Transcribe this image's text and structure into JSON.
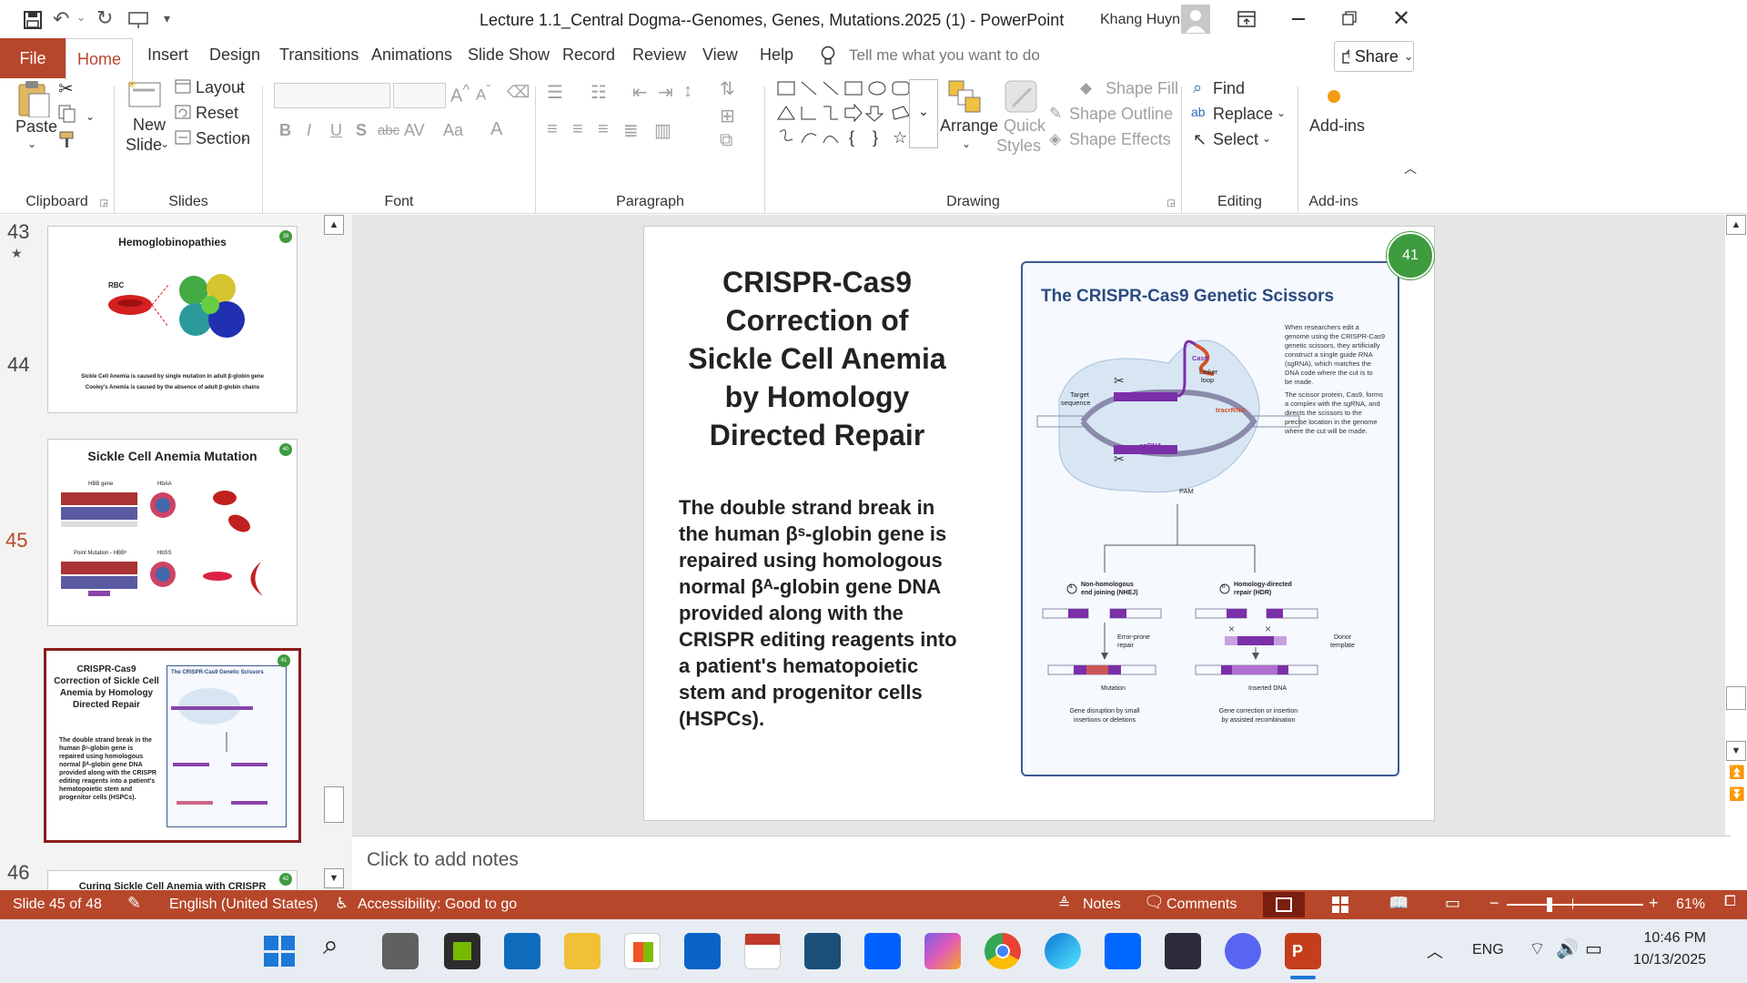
{
  "window": {
    "title": "Lecture 1.1_Central Dogma--Genomes, Genes, Mutations.2025 (1)  -  PowerPoint",
    "user": "Khang Huynh"
  },
  "tabs": [
    "File",
    "Home",
    "Insert",
    "Design",
    "Transitions",
    "Animations",
    "Slide Show",
    "Record",
    "Review",
    "View",
    "Help"
  ],
  "tell_me": "Tell me what you want to do",
  "share": "Share",
  "ribbon": {
    "clipboard": {
      "paste": "Paste",
      "label": "Clipboard"
    },
    "slides": {
      "new_slide_1": "New",
      "new_slide_2": "Slide",
      "layout": "Layout",
      "reset": "Reset",
      "section": "Section",
      "label": "Slides"
    },
    "font": {
      "bold": "B",
      "italic": "I",
      "underline": "U",
      "shadow": "S",
      "strike": "abc",
      "spacing": "AV",
      "case": "Aa",
      "color": "A",
      "label": "Font"
    },
    "paragraph": {
      "label": "Paragraph"
    },
    "drawing": {
      "arrange": "Arrange",
      "quick_styles_1": "Quick",
      "quick_styles_2": "Styles",
      "shape_fill": "Shape Fill",
      "shape_outline": "Shape Outline",
      "shape_effects": "Shape Effects",
      "label": "Drawing"
    },
    "editing": {
      "find": "Find",
      "replace": "Replace",
      "select": "Select",
      "label": "Editing"
    },
    "addins": {
      "button": "Add-ins",
      "label": "Add-ins"
    }
  },
  "thumbnails": [
    {
      "num": "43",
      "title": "Hemoglobinopathies",
      "badge": "38",
      "caption1": "Sickle Cell Anemia is caused by single mutation in adult β-globin gene",
      "caption2": "Cooley's Anemia is caused by the absence of adult β-globin chains",
      "rbc": "RBC"
    },
    {
      "num": "44",
      "title": "Sickle Cell Anemia Mutation",
      "badge": "40",
      "hbb": "HBB gene",
      "hbaa": "HbAA",
      "point": "Point Mutation - HBBˢ",
      "hbss": "HbSS"
    },
    {
      "num": "45",
      "title": "CRISPR-Cas9 Correction of Sickle Cell Anemia by Homology Directed Repair",
      "badge": "41",
      "fig_title": "The CRISPR-Cas9 Genetic Scissors",
      "body": "The double strand break in the human βˢ-globin gene is repaired using homologous normal βᴬ-globin gene DNA provided along with the CRISPR editing reagents into a patient's hematopoietic stem and progenitor cells (HSPCs)."
    },
    {
      "num": "46",
      "title": "Curing Sickle Cell Anemia with CRISPR",
      "badge": "42"
    }
  ],
  "slide": {
    "title_lines": [
      "CRISPR-Cas9",
      "Correction of",
      "Sickle Cell Anemia",
      "by Homology",
      "Directed Repair"
    ],
    "body_lines": [
      "The double strand break in",
      "the human βˢ-globin gene is",
      "repaired using homologous",
      "normal βᴬ-globin gene DNA",
      "provided along with the",
      "CRISPR editing reagents into",
      "a patient's hematopoietic",
      "stem and progenitor cells",
      "(HSPCs)."
    ],
    "badge": "41",
    "figure": {
      "title": "The CRISPR-Cas9 Genetic Scissors",
      "desc_lines": [
        "When researchers edit a",
        "genome using the CRISPR-Cas9",
        "genetic scissors, they artificially",
        "construct a single guide RNA",
        "(sgRNA), which matches the",
        "DNA code where the cut is to",
        "be made."
      ],
      "desc2_lines": [
        "The scissor protein, Cas9, forms",
        "a complex with the sgRNA, and",
        "directs the scissors to the",
        "precise location in the genome",
        "where the cut will be made."
      ],
      "labels": {
        "cas9": "Cas9",
        "linker": "Linker",
        "loop": "loop",
        "target1": "Target",
        "target2": "sequence",
        "tracr": "tracrRNA",
        "sgrna": "sgRNA",
        "pam": "PAM",
        "nhej_a": "a",
        "nhej1": "Non-homologous",
        "nhej2": "end joining (NHEJ)",
        "hdr_b": "b",
        "hdr1": "Homology-directed",
        "hdr2": "repair (HDR)",
        "err1": "Error-prone",
        "err2": "repair",
        "donor1": "Donor",
        "donor2": "template",
        "mutation": "Mutation",
        "inserted": "Inserted DNA",
        "res_a1": "Gene disruption by small",
        "res_a2": "insertions or deletions",
        "res_b1": "Gene correction or insertion",
        "res_b2": "by assisted recombination"
      }
    }
  },
  "notes_placeholder": "Click to add notes",
  "status": {
    "slide": "Slide 45 of 48",
    "language": "English (United States)",
    "accessibility": "Accessibility: Good to go",
    "notes": "Notes",
    "comments": "Comments",
    "zoom": "61%",
    "minus": "−",
    "plus": "+"
  },
  "taskbar": {
    "lang": "ENG",
    "time": "10:46 PM",
    "date": "10/13/2025"
  },
  "colors": {
    "accent": "#b7472a",
    "badge": "#3e9b3e",
    "fig_border": "#3b5b93",
    "purple": "#7b2fa8"
  }
}
